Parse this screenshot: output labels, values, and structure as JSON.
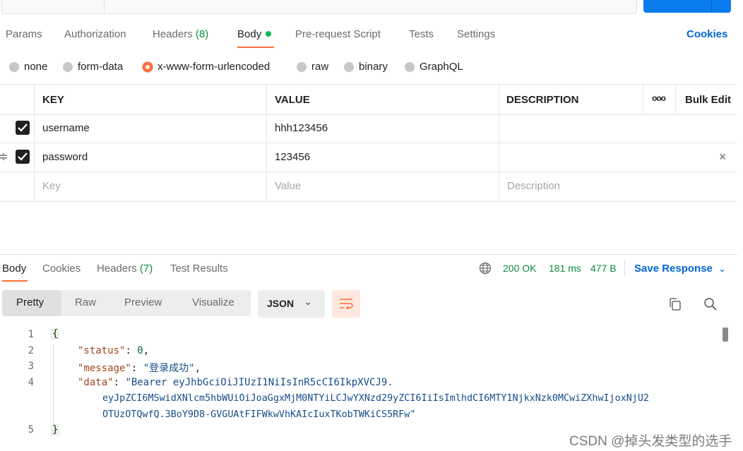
{
  "request_tabs": [
    {
      "label": "Params"
    },
    {
      "label": "Authorization"
    },
    {
      "label": "Headers",
      "count": "(8)"
    },
    {
      "label": "Body"
    },
    {
      "label": "Pre-request Script"
    },
    {
      "label": "Tests"
    },
    {
      "label": "Settings"
    }
  ],
  "cookies_link": "Cookies",
  "body_types": [
    "none",
    "form-data",
    "x-www-form-urlencoded",
    "raw",
    "binary",
    "GraphQL"
  ],
  "selected_body_type": "x-www-form-urlencoded",
  "table": {
    "headers": {
      "key": "KEY",
      "value": "VALUE",
      "description": "DESCRIPTION",
      "more": "ooo",
      "bulk_edit": "Bulk Edit"
    },
    "rows": [
      {
        "key": "username",
        "value": "hhh123456",
        "checked": true
      },
      {
        "key": "password",
        "value": "123456",
        "checked": true
      }
    ],
    "placeholders": {
      "key": "Key",
      "value": "Value",
      "description": "Description"
    }
  },
  "response": {
    "tabs": [
      {
        "label": "Body"
      },
      {
        "label": "Cookies"
      },
      {
        "label": "Headers",
        "count": "(7)"
      },
      {
        "label": "Test Results"
      }
    ],
    "status": "200 OK",
    "time": "181 ms",
    "size": "477 B",
    "save_response": "Save Response",
    "view_modes": [
      "Pretty",
      "Raw",
      "Preview",
      "Visualize"
    ],
    "format": "JSON",
    "lines": [
      "1",
      "2",
      "3",
      "4",
      "5"
    ],
    "json": {
      "open_brace": "{",
      "close_brace": "}",
      "status_key": "\"status\"",
      "status_value": "0",
      "message_key": "\"message\"",
      "message_value": "\"登录成功\"",
      "data_key": "\"data\"",
      "data_value_1": "\"Bearer eyJhbGciOiJIUzI1NiIsInR5cCI6IkpXVCJ9.",
      "data_value_2": "eyJpZCI6MSwidXNlcm5hbWUiOiJoaGgxMjM0NTYiLCJwYXNzd29yZCI6IiIsImlhdCI6MTY1NjkxNzk0MCwiZXhwIjoxNjU2",
      "data_value_3": "OTUzOTQwfQ.3BoY9D8-GVGUAtFIFWkwVhKAIcIuxTKobTWKiCS5RFw\""
    }
  },
  "watermark": "CSDN @掉头发类型的选手",
  "colors": {
    "accent": "#ff6c37",
    "link": "#0265d2",
    "success": "#0c8a3d",
    "send": "#097bed"
  }
}
